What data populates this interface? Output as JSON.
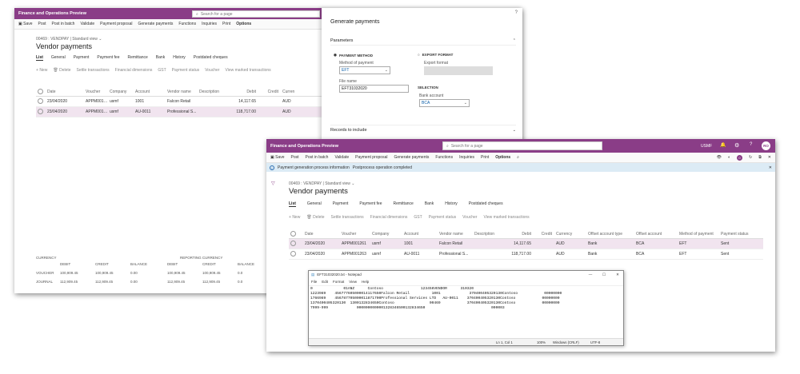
{
  "app_title": "Finance and Operations Preview",
  "search_placeholder": "Search for a page",
  "toolbar": {
    "save": "Save",
    "post": "Post",
    "post_in_batch": "Post in batch",
    "validate": "Validate",
    "payment_proposal": "Payment proposal",
    "generate_payments": "Generate payments",
    "functions": "Functions",
    "inquiries": "Inquiries",
    "print": "Print",
    "options": "Options"
  },
  "breadcrumb": "00469 : VENDPAY",
  "view": "Standard view",
  "page_title": "Vendor payments",
  "tabs": [
    "List",
    "General",
    "Payment",
    "Payment fee",
    "Remittance",
    "Bank",
    "History",
    "Postdated cheques"
  ],
  "actions": {
    "new": "New",
    "delete": "Delete",
    "settle": "Settle transactions",
    "fin_dims": "Financial dimensions",
    "gst": "GST",
    "pay_status": "Payment status",
    "voucher": "Voucher",
    "view_marked": "View marked transactions"
  },
  "back": {
    "columns": [
      "Date",
      "Voucher",
      "Company",
      "Account",
      "Vendor name",
      "Description",
      "Debit",
      "Credit",
      "Curren"
    ],
    "rows": [
      [
        "23/04/2020",
        "APPM001261",
        "usmf",
        "1001",
        "Falcon Retail",
        "",
        "14,117.65",
        "",
        "AUD"
      ],
      [
        "23/04/2020",
        "APPM001263",
        "usmf",
        "AU-0011",
        "Professional S...",
        "",
        "118,717.00",
        "",
        "AUD"
      ]
    ],
    "totals": {
      "currency": "CURRENCY",
      "reporting_currency": "REPORTING CURRENCY",
      "headers": [
        "DEBIT",
        "CREDIT",
        "BALANCE",
        "DEBIT",
        "CREDIT",
        "BALANCE"
      ],
      "rows": [
        {
          "label": "VOUCHER",
          "vals": [
            "100,909.45",
            "100,909.45",
            "0.00",
            "100,909.45",
            "100,909.45",
            "0.0"
          ]
        },
        {
          "label": "JOURNAL",
          "vals": [
            "112,909.45",
            "112,909.45",
            "0.00",
            "112,909.45",
            "112,909.45",
            "0.0"
          ]
        }
      ]
    }
  },
  "dialog": {
    "help": "?",
    "title": "Generate payments",
    "parameters": "Parameters",
    "payment_method_hdr": "PAYMENT METHOD",
    "method_label": "Method of payment",
    "method_value": "EFT",
    "file_label": "File name",
    "file_value": "EFT31032020",
    "export_hdr": "EXPORT FORMAT",
    "export_label": "Export format",
    "selection": "SELECTION",
    "bank_label": "Bank account",
    "bank_value": "BCA",
    "records": "Records to include"
  },
  "front": {
    "user": "USMF",
    "avatar": "RO",
    "badge": "0",
    "info_text": "Payment generation process information",
    "info_text2": "Postprocess operation completed",
    "columns": [
      "Date",
      "Voucher",
      "Company",
      "Account",
      "Vendor name",
      "Description",
      "Debit",
      "Credit",
      "Currency",
      "Offset account type",
      "Offset account",
      "Method of payment",
      "Payment status"
    ],
    "rows": [
      [
        "23/04/2020",
        "APPM001261",
        "usmf",
        "1001",
        "Falcon Retail",
        "",
        "14,117.65",
        "",
        "AUD",
        "Bank",
        "BCA",
        "EFT",
        "Sent"
      ],
      [
        "23/04/2020",
        "APPM001263",
        "usmf",
        "AU-0011",
        "Professional S...",
        "",
        "118,717.00",
        "",
        "AUD",
        "Bank",
        "BCA",
        "EFT",
        "Sent"
      ]
    ]
  },
  "notepad": {
    "title": "EFT31032020.txt - Notepad",
    "menu": [
      "File",
      "Edit",
      "Format",
      "View",
      "Help"
    ],
    "lines": [
      "0              01ANZ      Contoso                 123456VENDOR      310320",
      "1223989    456777605000014117650Falcon Retail          1001             370400405320130Contoso            00000000",
      "1766989    456787705000011871700Professional Services LTD   AU-0011    370400405320130Contoso            00000000",
      "1370400405320130  1300132834650Contoso                00469            370400405320130Contoso            00000000",
      "7999-999             0000000000001328346500132834650                              000003"
    ],
    "status": {
      "pos": "Ln 1, Col 1",
      "zoom": "100%",
      "eol": "Windows (CRLF)",
      "enc": "UTF-8"
    }
  },
  "colors": {
    "accent": "#8a3d87",
    "selected_row": "#f1e4ef",
    "info_bar": "#dcebf5"
  }
}
